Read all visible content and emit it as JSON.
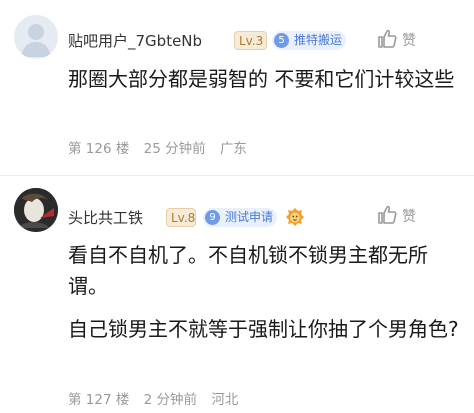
{
  "posts": [
    {
      "username": "贴吧用户_7GbteNb",
      "level": "Lv.3",
      "tag_number": "5",
      "tag_label": "推特搬运",
      "like_label": "赞",
      "content": [
        "那圈大部分都是弱智的 不要和它们计较这些"
      ],
      "floor": "第 126 楼",
      "time": "25 分钟前",
      "location": "广东"
    },
    {
      "username": "头比共工铁",
      "level": "Lv.8",
      "tag_number": "9",
      "tag_label": "测试申请",
      "like_label": "赞",
      "content": [
        "看自不自机了。不自机锁不锁男主都无所谓。",
        "自己锁男主不就等于强制让你抽了个男角色?"
      ],
      "floor": "第 127 楼",
      "time": "2 分钟前",
      "location": "河北"
    }
  ],
  "colors": {
    "level_bg": "#f6ead8",
    "level_text": "#b07c2c",
    "tag_bg": "#e9f0fb",
    "tag_text": "#4a7ad3",
    "meta_text": "#9a9a9a"
  },
  "icons": [
    "default-avatar-icon",
    "user-avatar",
    "thumbs-up-icon",
    "lion-badge-icon"
  ]
}
